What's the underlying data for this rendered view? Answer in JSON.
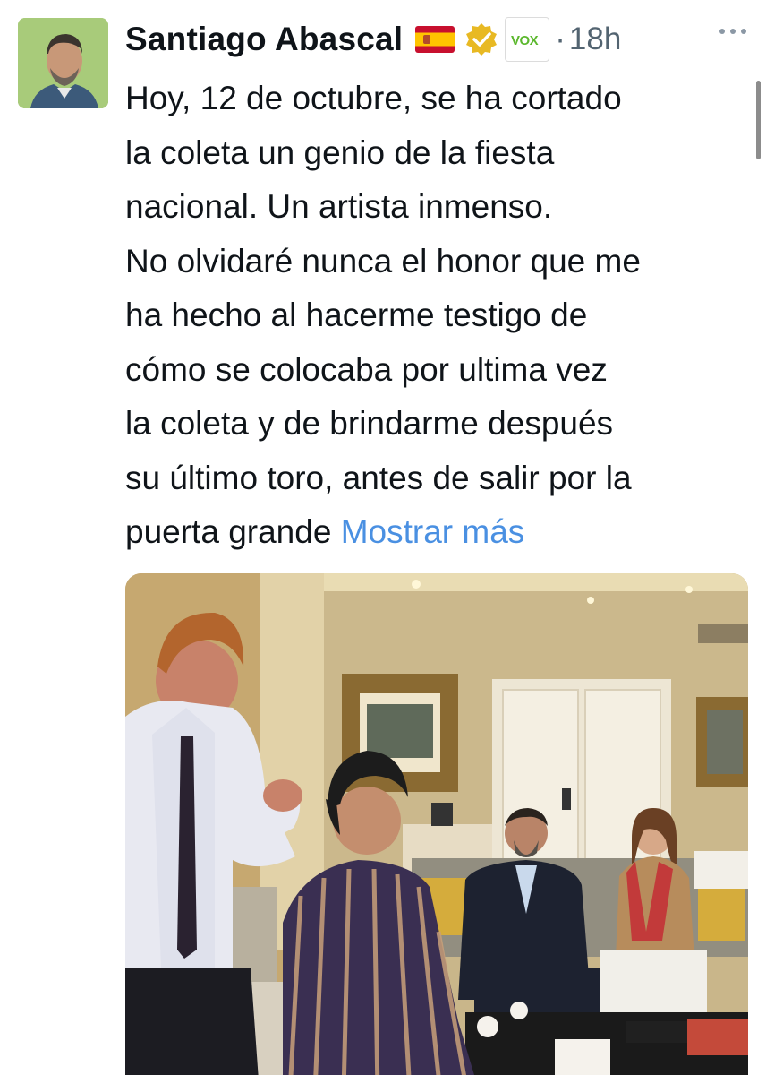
{
  "tweet": {
    "author_name": "Santiago Abascal",
    "time_ago": "18h",
    "separator": "·",
    "party_badge": "VOX",
    "lines": [
      "Hoy, 12 de octubre, se ha cortado",
      "la coleta un genio de la fiesta",
      "nacional.  Un artista inmenso.",
      "No olvidaré nunca el honor que me",
      "ha hecho al hacerme testigo de",
      "cómo se colocaba por ultima vez",
      "la coleta  y de brindarme después",
      "su último toro, antes de salir por la",
      "puerta grande"
    ],
    "show_more": "Mostrar más"
  },
  "colors": {
    "link": "#4a90e2",
    "text": "#0f1419",
    "muted": "#536471",
    "verified_gold": "#e8b923",
    "vox_green": "#5cb82e"
  },
  "icons": {
    "flag": "spain-flag-icon",
    "verified": "verified-gold-badge-icon",
    "affiliate": "vox-party-badge-icon",
    "more": "more-options-icon"
  }
}
